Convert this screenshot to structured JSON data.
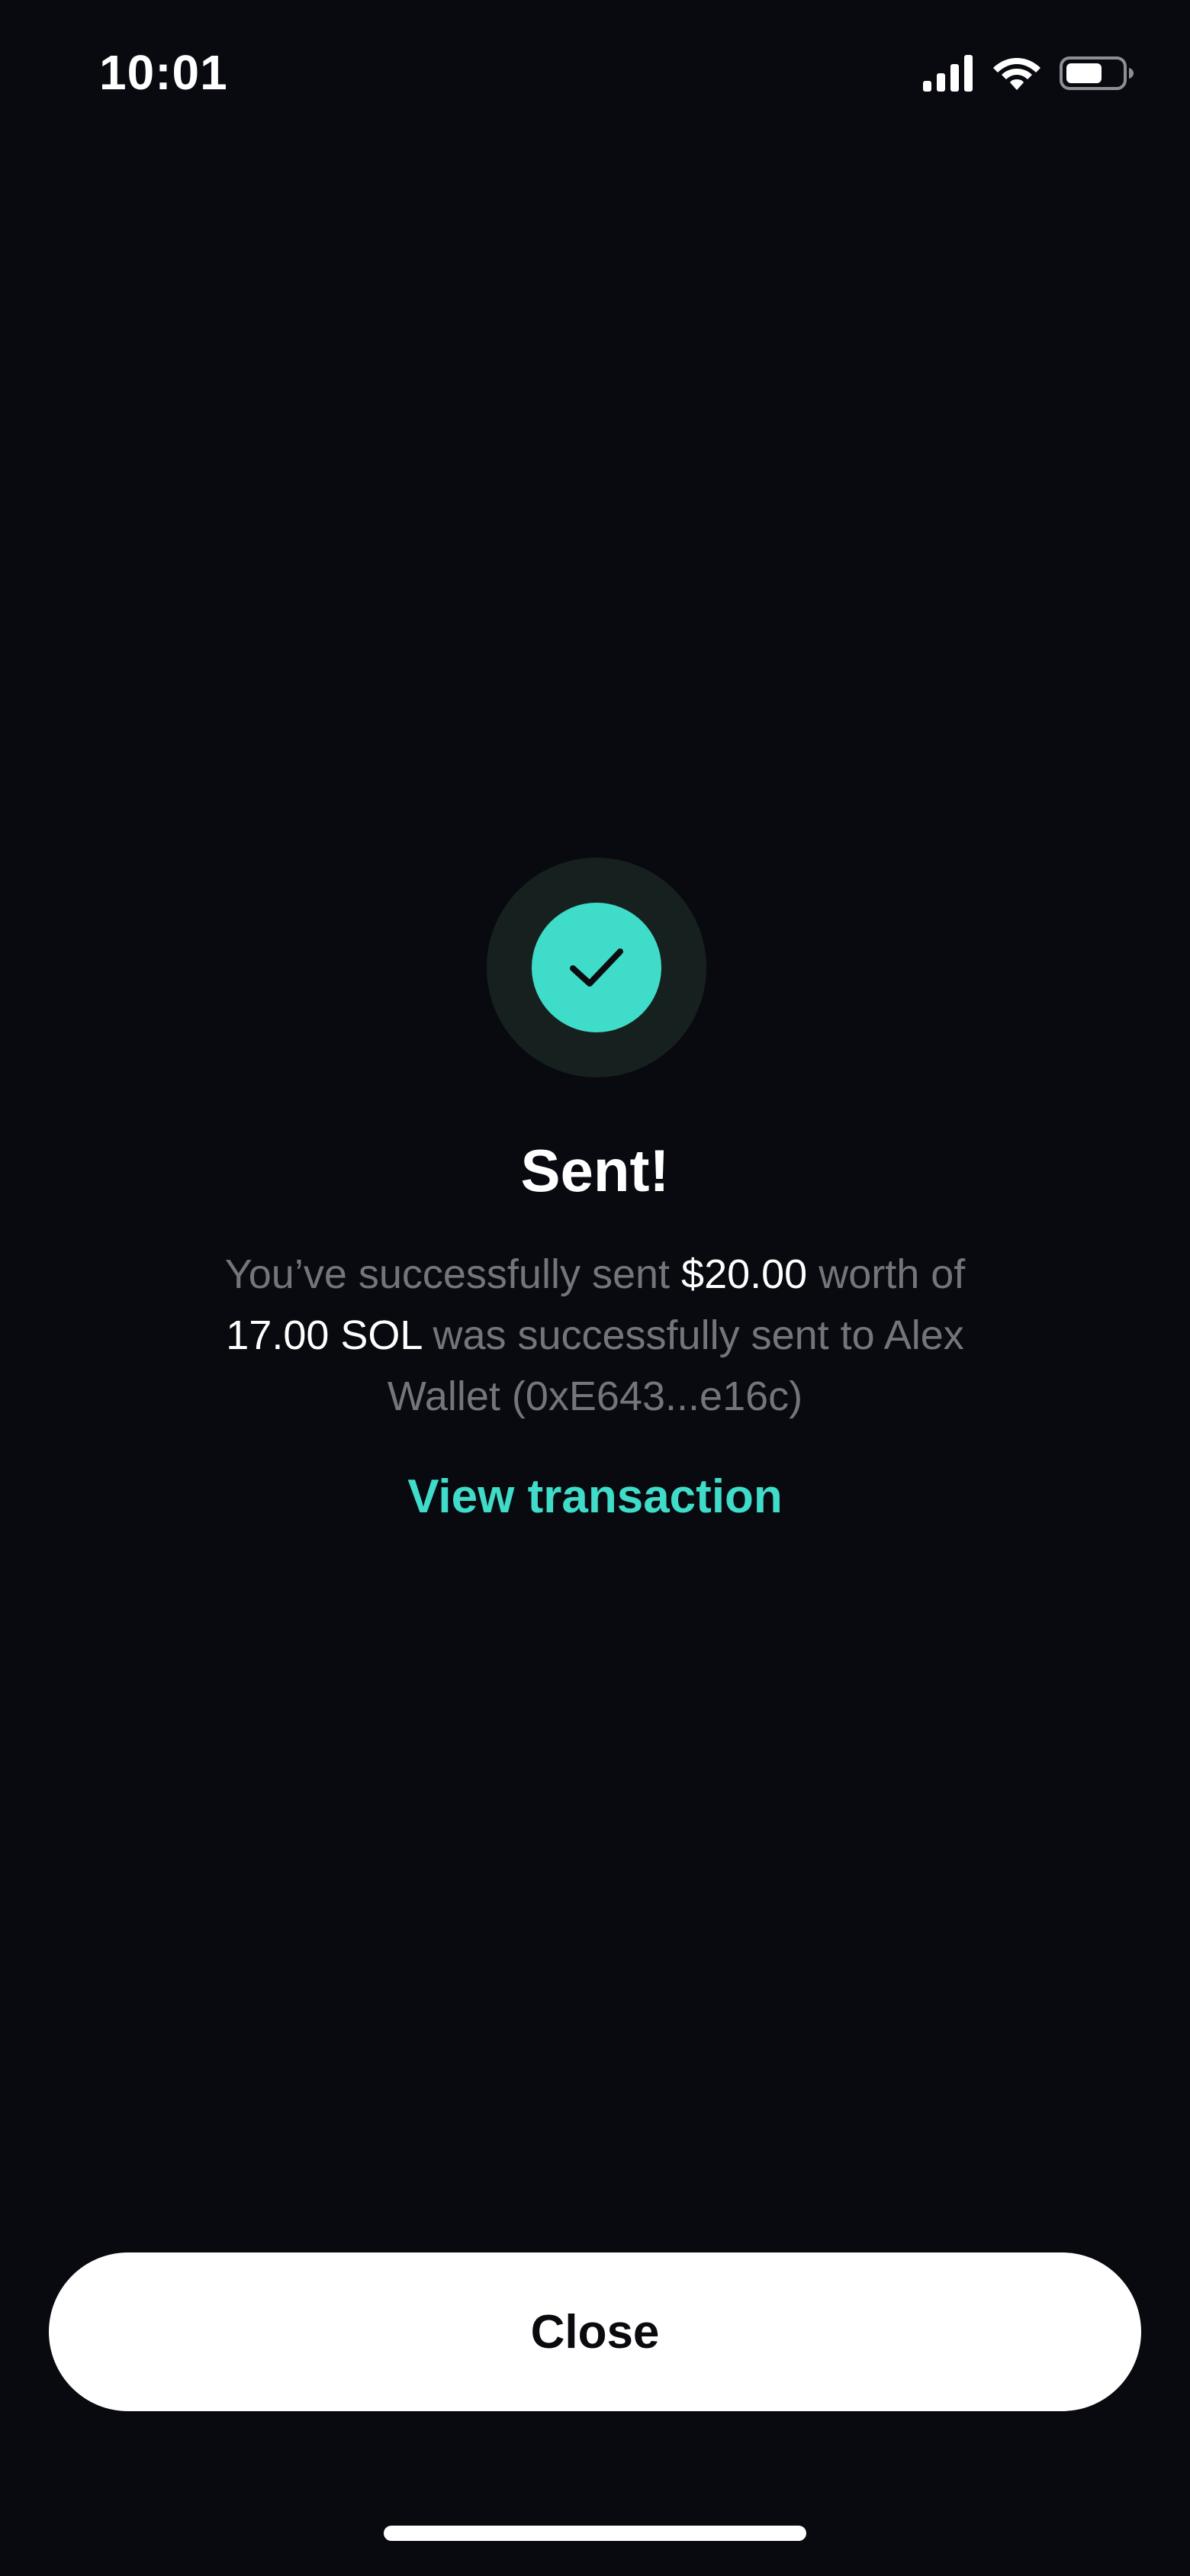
{
  "status_bar": {
    "time": "10:01",
    "icons": [
      "signal-icon",
      "wifi-icon",
      "battery-icon"
    ]
  },
  "success_icon": {
    "name": "check-icon",
    "color": "#3fdcc9",
    "ring_color": "#16211f"
  },
  "title": "Sent!",
  "message": {
    "part1": "You’ve successfully sent ",
    "amount_usd": "$20.00",
    "part2": " worth of ",
    "amount_token": "17.00 SOL",
    "part3": " was successfully sent to Alex Wallet (0xE643...e16c)"
  },
  "view_transaction_label": "View transaction",
  "close_label": "Close",
  "colors": {
    "background": "#090a10",
    "accent": "#3fdcc9",
    "muted_text": "#73757c",
    "button_bg": "#ffffff"
  }
}
